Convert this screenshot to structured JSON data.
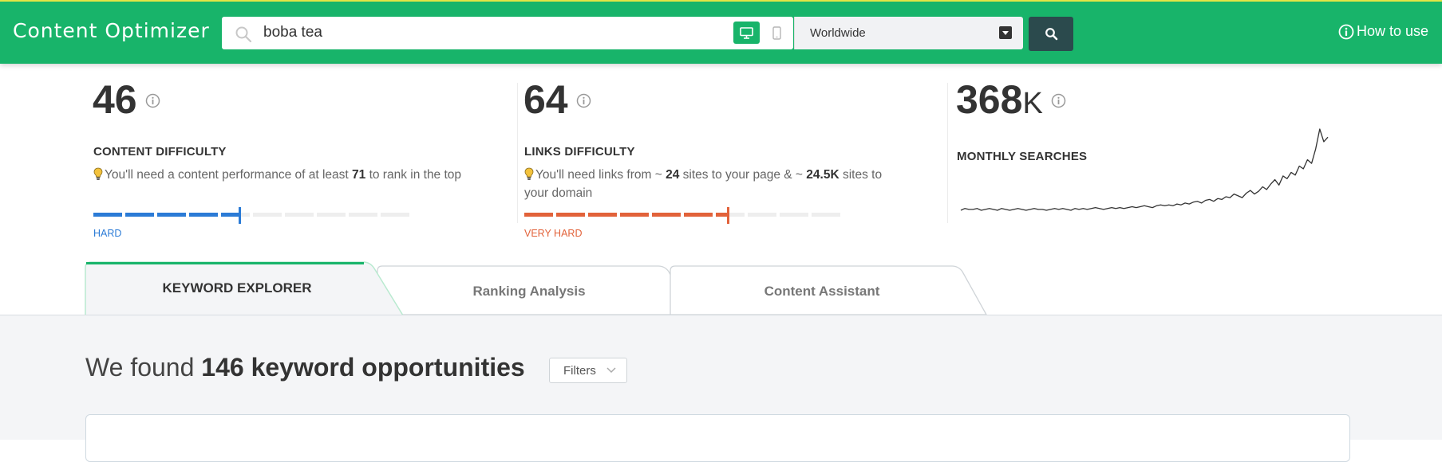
{
  "header": {
    "brand": "Content Optimizer",
    "search": {
      "value": "boba tea",
      "placeholder": ""
    },
    "device": {
      "selected": "desktop"
    },
    "location": {
      "selected": "Worldwide"
    },
    "help_link": "How to use",
    "colors": {
      "bar": "#18b46a",
      "search_button": "#2b4a4d"
    }
  },
  "metrics": {
    "content_difficulty": {
      "value": "46",
      "title": "CONTENT DIFFICULTY",
      "desc_prefix": "You'll need a content performance of at least ",
      "desc_value": "71",
      "desc_suffix": " to rank in the top",
      "level": "HARD",
      "score": 46,
      "color": "#2b7bd6"
    },
    "links_difficulty": {
      "value": "64",
      "title": "LINKS DIFFICULTY",
      "desc_prefix": "You'll need links from ~ ",
      "desc_sites": "24",
      "desc_middle": " sites to your page & ~ ",
      "desc_domain_sites": "24.5K",
      "desc_suffix": " sites to your domain",
      "level": "VERY HARD",
      "score": 64,
      "color": "#e2623a"
    },
    "monthly_searches": {
      "value": "368",
      "unit": "K",
      "title": "MONTHLY SEARCHES",
      "trend": [
        6,
        8,
        7,
        7,
        8,
        6,
        7,
        8,
        7,
        6,
        8,
        7,
        6,
        7,
        8,
        7,
        6,
        7,
        8,
        7,
        7,
        6,
        7,
        8,
        7,
        8,
        7,
        6,
        8,
        7,
        8,
        7,
        8,
        9,
        8,
        7,
        8,
        9,
        8,
        9,
        8,
        9,
        10,
        9,
        10,
        11,
        10,
        9,
        11,
        12,
        11,
        12,
        11,
        13,
        12,
        14,
        13,
        15,
        16,
        14,
        17,
        18,
        16,
        19,
        18,
        21,
        20,
        24,
        22,
        20,
        25,
        28,
        24,
        27,
        32,
        29,
        35,
        40,
        34,
        44,
        41,
        48,
        45,
        55,
        52,
        62,
        58,
        74,
        96,
        82,
        87
      ]
    }
  },
  "tabs": [
    {
      "label": "KEYWORD EXPLORER",
      "active": true
    },
    {
      "label": "Ranking Analysis",
      "active": false
    },
    {
      "label": "Content Assistant",
      "active": false
    }
  ],
  "results": {
    "prefix": "We found ",
    "count_label": "146 keyword opportunities",
    "filters_label": "Filters"
  }
}
